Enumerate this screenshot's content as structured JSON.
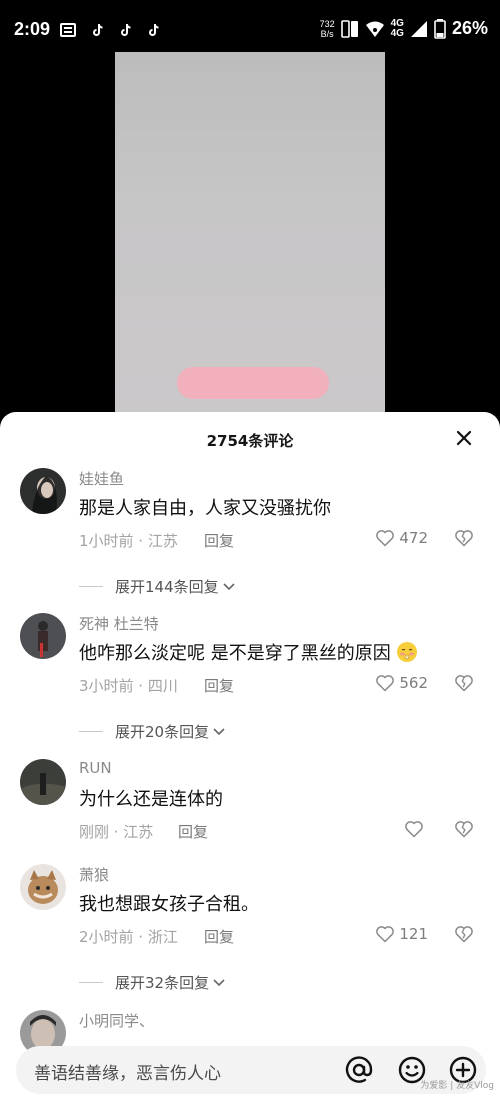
{
  "status_bar": {
    "time": "2:09",
    "net_speed_value": "732",
    "net_speed_unit": "B/s",
    "network_a": "4G",
    "network_b": "4G",
    "battery": "26%"
  },
  "comments_panel": {
    "title": "2754条评论",
    "comments": [
      {
        "username": "娃娃鱼",
        "text": "那是人家自由，人家又没骚扰你",
        "meta": "1小时前 · 江苏",
        "reply_label": "回复",
        "likes": "472",
        "expand_label": "展开144条回复"
      },
      {
        "username": "死神  杜兰特",
        "text": "他咋那么淡定呢 是不是穿了黑丝的原因",
        "meta": "3小时前 · 四川",
        "reply_label": "回复",
        "likes": "562",
        "expand_label": "展开20条回复"
      },
      {
        "username": "RUN",
        "text": "为什么还是连体的",
        "meta": "刚刚 · 江苏",
        "reply_label": "回复",
        "likes": ""
      },
      {
        "username": "萧狼",
        "text": "我也想跟女孩子合租。",
        "meta": "2小时前 · 浙江",
        "reply_label": "回复",
        "likes": "121",
        "expand_label": "展开32条回复"
      },
      {
        "username": "小明同学、"
      }
    ]
  },
  "input_bar": {
    "placeholder": "善语结善缘，恶言伤人心"
  },
  "watermark": "为爱影 | 友友Vlog",
  "colors": {
    "video_bg": "#c7c6c7",
    "pink_bar": "#f1b0bb",
    "sheet_bg": "#ffffff",
    "input_bg": "#f3f3f3"
  }
}
